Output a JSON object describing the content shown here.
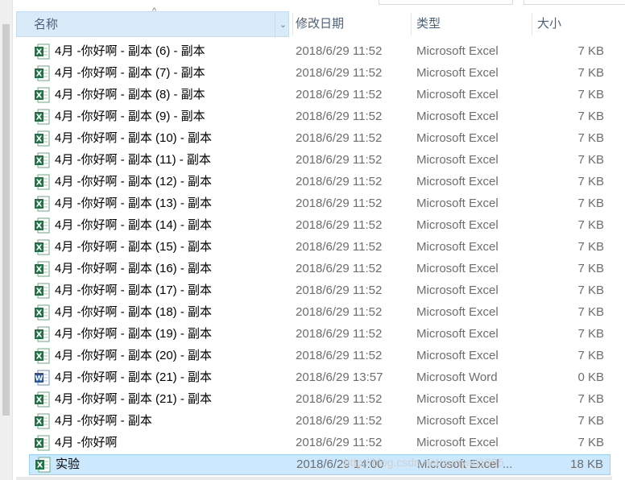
{
  "columns": {
    "name": "名称",
    "date": "修改日期",
    "type": "类型",
    "size": "大小"
  },
  "files": [
    {
      "name": "4月 -你好啊 - 副本 (6) - 副本",
      "date": "2018/6/29 11:52",
      "type": "Microsoft Excel",
      "size": "7 KB",
      "icon": "excel-file-icon"
    },
    {
      "name": "4月 -你好啊 - 副本 (7) - 副本",
      "date": "2018/6/29 11:52",
      "type": "Microsoft Excel",
      "size": "7 KB",
      "icon": "excel-file-icon"
    },
    {
      "name": "4月 -你好啊 - 副本 (8) - 副本",
      "date": "2018/6/29 11:52",
      "type": "Microsoft Excel",
      "size": "7 KB",
      "icon": "excel-file-icon"
    },
    {
      "name": "4月 -你好啊 - 副本 (9) - 副本",
      "date": "2018/6/29 11:52",
      "type": "Microsoft Excel",
      "size": "7 KB",
      "icon": "excel-file-icon"
    },
    {
      "name": "4月 -你好啊 - 副本 (10) - 副本",
      "date": "2018/6/29 11:52",
      "type": "Microsoft Excel",
      "size": "7 KB",
      "icon": "excel-file-icon"
    },
    {
      "name": "4月 -你好啊 - 副本 (11) - 副本",
      "date": "2018/6/29 11:52",
      "type": "Microsoft Excel",
      "size": "7 KB",
      "icon": "excel-file-icon"
    },
    {
      "name": "4月 -你好啊 - 副本 (12) - 副本",
      "date": "2018/6/29 11:52",
      "type": "Microsoft Excel",
      "size": "7 KB",
      "icon": "excel-file-icon"
    },
    {
      "name": "4月 -你好啊 - 副本 (13) - 副本",
      "date": "2018/6/29 11:52",
      "type": "Microsoft Excel",
      "size": "7 KB",
      "icon": "excel-file-icon"
    },
    {
      "name": "4月 -你好啊 - 副本 (14) - 副本",
      "date": "2018/6/29 11:52",
      "type": "Microsoft Excel",
      "size": "7 KB",
      "icon": "excel-file-icon"
    },
    {
      "name": "4月 -你好啊 - 副本 (15) - 副本",
      "date": "2018/6/29 11:52",
      "type": "Microsoft Excel",
      "size": "7 KB",
      "icon": "excel-file-icon"
    },
    {
      "name": "4月 -你好啊 - 副本 (16) - 副本",
      "date": "2018/6/29 11:52",
      "type": "Microsoft Excel",
      "size": "7 KB",
      "icon": "excel-file-icon"
    },
    {
      "name": "4月 -你好啊 - 副本 (17) - 副本",
      "date": "2018/6/29 11:52",
      "type": "Microsoft Excel",
      "size": "7 KB",
      "icon": "excel-file-icon"
    },
    {
      "name": "4月 -你好啊 - 副本 (18) - 副本",
      "date": "2018/6/29 11:52",
      "type": "Microsoft Excel",
      "size": "7 KB",
      "icon": "excel-file-icon"
    },
    {
      "name": "4月 -你好啊 - 副本 (19) - 副本",
      "date": "2018/6/29 11:52",
      "type": "Microsoft Excel",
      "size": "7 KB",
      "icon": "excel-file-icon"
    },
    {
      "name": "4月 -你好啊 - 副本 (20) - 副本",
      "date": "2018/6/29 11:52",
      "type": "Microsoft Excel",
      "size": "7 KB",
      "icon": "excel-file-icon"
    },
    {
      "name": "4月 -你好啊 - 副本 (21) - 副本",
      "date": "2018/6/29 13:57",
      "type": "Microsoft Word",
      "size": "0 KB",
      "icon": "word-file-icon"
    },
    {
      "name": "4月 -你好啊 - 副本 (21) - 副本",
      "date": "2018/6/29 11:52",
      "type": "Microsoft Excel",
      "size": "7 KB",
      "icon": "excel-file-icon"
    },
    {
      "name": "4月 -你好啊 - 副本",
      "date": "2018/6/29 11:52",
      "type": "Microsoft Excel",
      "size": "7 KB",
      "icon": "excel-file-icon"
    },
    {
      "name": "4月 -你好啊",
      "date": "2018/6/29 11:52",
      "type": "Microsoft Excel",
      "size": "7 KB",
      "icon": "excel-file-icon"
    },
    {
      "name": "实验",
      "date": "2018/6/29 14:00",
      "type": "Microsoft Excel ...",
      "size": "18 KB",
      "icon": "excel-file-icon",
      "selected": true
    }
  ],
  "watermark": "http://blog.csdn.net/sunyan1995",
  "colors": {
    "header_selected_bg": "#d9ebf9",
    "row_selected_bg": "#cce8ff",
    "row_selected_border": "#99d1ff",
    "excel_green": "#217346",
    "word_blue": "#2b579a"
  }
}
